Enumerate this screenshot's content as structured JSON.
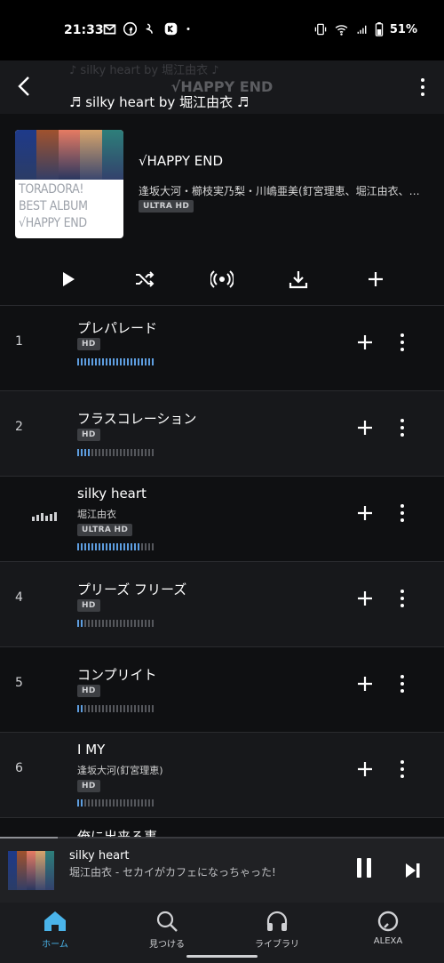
{
  "status_bar": {
    "time": "21:33",
    "battery": "51%",
    "notification_icons": [
      "gmail-icon",
      "facebook-icon",
      "app-icon",
      "app-icon",
      "dot-icon"
    ]
  },
  "header": {
    "title": "√HAPPY END",
    "ghost_caption": "♪ silky heart by 堀江由衣 ♪",
    "now_playing_caption": "♬ silky heart by 堀江由衣 ♬"
  },
  "album": {
    "cover_text": [
      "TORADORA!",
      "BEST ALBUM",
      "√HAPPY END"
    ],
    "title": "√HAPPY END",
    "artist": "逢坂大河・櫛枝実乃梨・川嶋亜美(釘宮理恵、堀江由衣、…",
    "quality": "ULTRA HD"
  },
  "actions": [
    "play-icon",
    "shuffle-icon",
    "radio-icon",
    "download-icon",
    "add-icon"
  ],
  "tracks": [
    {
      "num": "1",
      "title": "プレパレード",
      "artist": "",
      "badge": "HD",
      "level": 1.0
    },
    {
      "num": "2",
      "title": "フラスコレーション",
      "artist": "",
      "badge": "HD",
      "level": 0.2
    },
    {
      "num": "",
      "title": "silky heart",
      "artist": "堀江由衣",
      "badge": "ULTRA HD",
      "level": 0.8,
      "playing": true
    },
    {
      "num": "4",
      "title": "プリーズ フリーズ",
      "artist": "",
      "badge": "HD",
      "level": 0.1
    },
    {
      "num": "5",
      "title": "コンプリイト",
      "artist": "",
      "badge": "HD",
      "level": 0.1
    },
    {
      "num": "6",
      "title": "I MY",
      "artist": "逢坂大河(釘宮理恵)",
      "badge": "HD",
      "level": 0.1
    },
    {
      "num": "",
      "title": "俺に出来る事",
      "artist": "",
      "badge": "",
      "level": 0
    }
  ],
  "mini_player": {
    "title": "silky heart",
    "subtitle": "堀江由衣 - セカイがカフェになっちゃった!",
    "progress": 0.13
  },
  "nav": {
    "home": "ホーム",
    "search": "見つける",
    "library": "ライブラリ",
    "alexa": "ALEXA"
  },
  "colors": {
    "accent": "#4ab4ea",
    "quality_bar": "#5e9ee0",
    "background": "#0f1012"
  }
}
